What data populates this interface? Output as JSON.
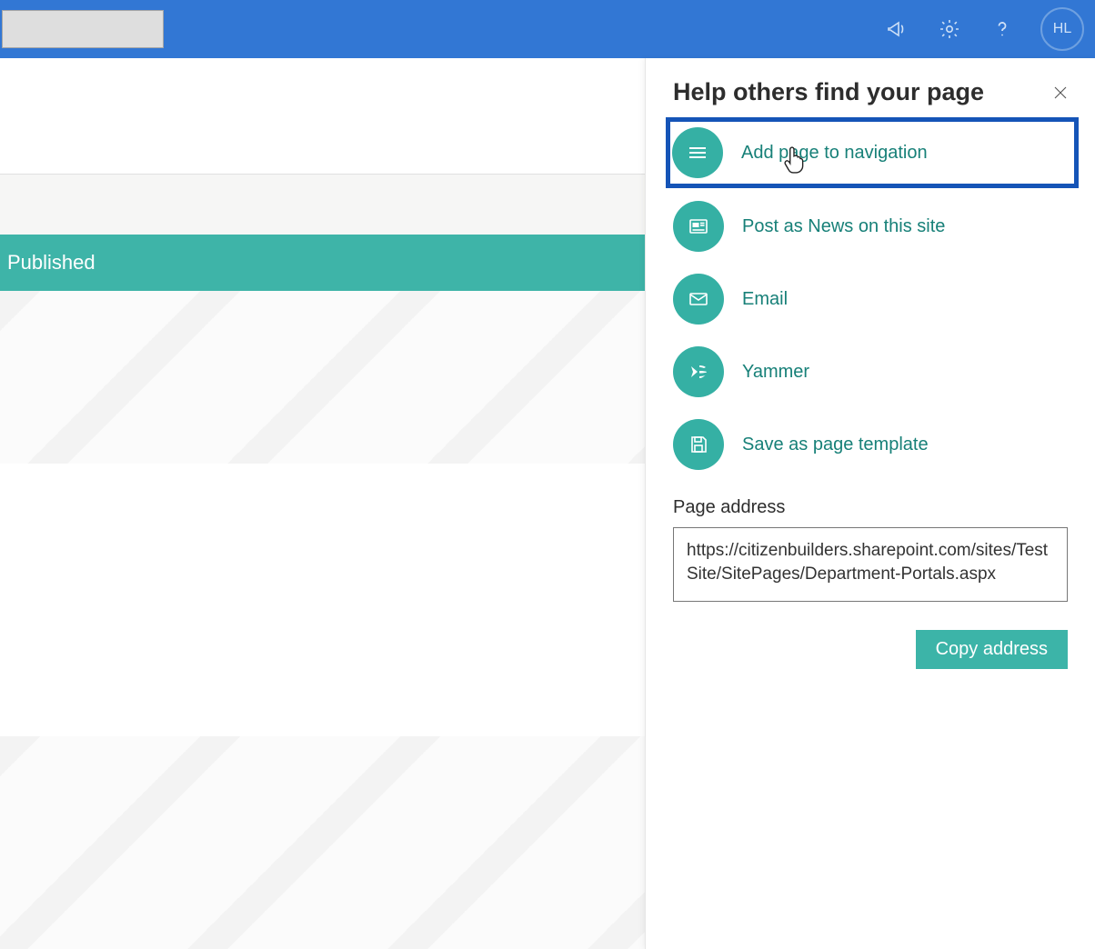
{
  "header": {
    "avatar_initials": "HL"
  },
  "content": {
    "published_banner": "Published"
  },
  "panel": {
    "title": "Help others find your page",
    "options": [
      {
        "label": "Add page to navigation",
        "icon": "hamburger",
        "highlight": true
      },
      {
        "label": "Post as News on this site",
        "icon": "news",
        "highlight": false
      },
      {
        "label": "Email",
        "icon": "mail",
        "highlight": false
      },
      {
        "label": "Yammer",
        "icon": "yammer",
        "highlight": false
      },
      {
        "label": "Save as page template",
        "icon": "save",
        "highlight": false
      }
    ],
    "page_address_label": "Page address",
    "page_address_value": "https://citizenbuilders.sharepoint.com/sites/TestSite/SitePages/Department-Portals.aspx",
    "copy_button": "Copy address"
  },
  "colors": {
    "topbar": "#3277d4",
    "accent": "#35b0a4",
    "highlight_border": "#1554b7",
    "link_text": "#178078"
  }
}
